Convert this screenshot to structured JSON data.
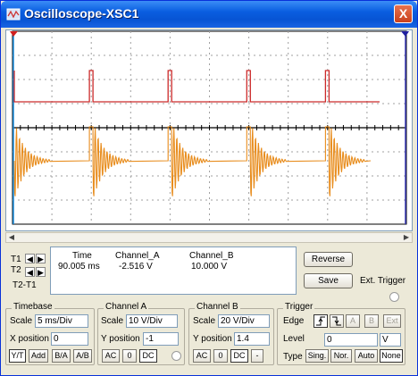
{
  "window": {
    "title": "Oscilloscope-XSC1",
    "close_label": "X"
  },
  "colors": {
    "channel_a": "#cc2a2a",
    "channel_b": "#e88c1c",
    "title_bar": "#0a5ee0",
    "cursor1": "#1b8fe0",
    "cursor2": "#3a3ab8"
  },
  "cursors": {
    "t1_label": "T1",
    "t2_label": "T2",
    "t2t1_label": "T2-T1"
  },
  "readout": {
    "headers": {
      "time": "Time",
      "channel_a": "Channel_A",
      "channel_b": "Channel_B"
    },
    "time": "90.005 ms",
    "channel_a": "-2.516 V",
    "channel_b": "10.000 V"
  },
  "buttons": {
    "reverse": "Reverse",
    "save": "Save",
    "ext_trigger": "Ext. Trigger"
  },
  "timebase": {
    "title": "Timebase",
    "scale_label": "Scale",
    "scale_value": "5 ms/Div",
    "xpos_label": "X position",
    "xpos_value": "0",
    "modes": [
      "Y/T",
      "Add",
      "B/A",
      "A/B"
    ]
  },
  "channel_a": {
    "title": "Channel A",
    "scale_label": "Scale",
    "scale_value": "10  V/Div",
    "ypos_label": "Y position",
    "ypos_value": "-1",
    "coupling": [
      "AC",
      "0",
      "DC"
    ]
  },
  "channel_b": {
    "title": "Channel B",
    "scale_label": "Scale",
    "scale_value": "20  V/Div",
    "ypos_label": "Y position",
    "ypos_value": "1.4",
    "coupling": [
      "AC",
      "0",
      "DC",
      "-"
    ]
  },
  "trigger": {
    "title": "Trigger",
    "edge_label": "Edge",
    "edge_buttons": [
      "A",
      "B",
      "Ext"
    ],
    "level_label": "Level",
    "level_value": "0",
    "level_unit": "V",
    "type_label": "Type",
    "types": [
      "Sing.",
      "Nor.",
      "Auto",
      "None"
    ]
  }
}
